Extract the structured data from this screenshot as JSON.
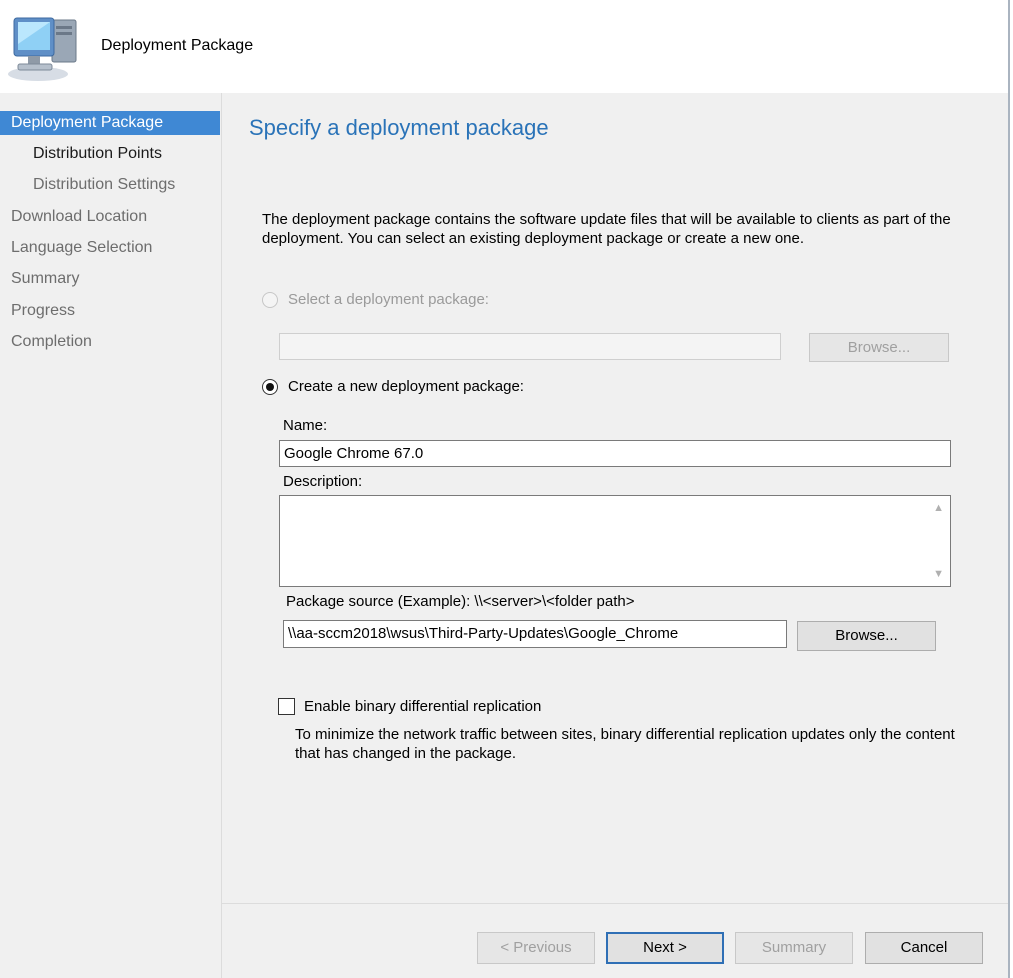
{
  "header": {
    "title": "Deployment Package",
    "icon": "computer-icon"
  },
  "sidebar": {
    "items": [
      {
        "label": "Deployment Package"
      },
      {
        "label": "Distribution Points"
      },
      {
        "label": "Distribution Settings"
      },
      {
        "label": "Download Location"
      },
      {
        "label": "Language Selection"
      },
      {
        "label": "Summary"
      },
      {
        "label": "Progress"
      },
      {
        "label": "Completion"
      }
    ]
  },
  "main": {
    "title": "Specify a deployment package",
    "intro": "The deployment package contains the software update files that will be available to clients as part of the deployment. You can select an existing deployment package or create a new one.",
    "select_existing": {
      "label": "Select a deployment package:",
      "value": "",
      "browse_label": "Browse..."
    },
    "create_new": {
      "label": "Create a new deployment package:"
    },
    "name": {
      "label": "Name:",
      "value": "Google Chrome 67.0"
    },
    "description": {
      "label": "Description:",
      "value": ""
    },
    "package_source": {
      "label": "Package source (Example): \\\\<server>\\<folder path>",
      "value": "\\\\aa-sccm2018\\wsus\\Third-Party-Updates\\Google_Chrome",
      "browse_label": "Browse..."
    },
    "binary_replication": {
      "label": "Enable binary differential replication",
      "note": "To minimize the network traffic between sites, binary differential replication updates only the content that has changed in the package."
    }
  },
  "footer": {
    "previous": "< Previous",
    "next": "Next >",
    "summary": "Summary",
    "cancel": "Cancel"
  },
  "colors": {
    "accent": "#3f88d4",
    "title": "#2a73b8",
    "panel": "#f0f0f0"
  }
}
